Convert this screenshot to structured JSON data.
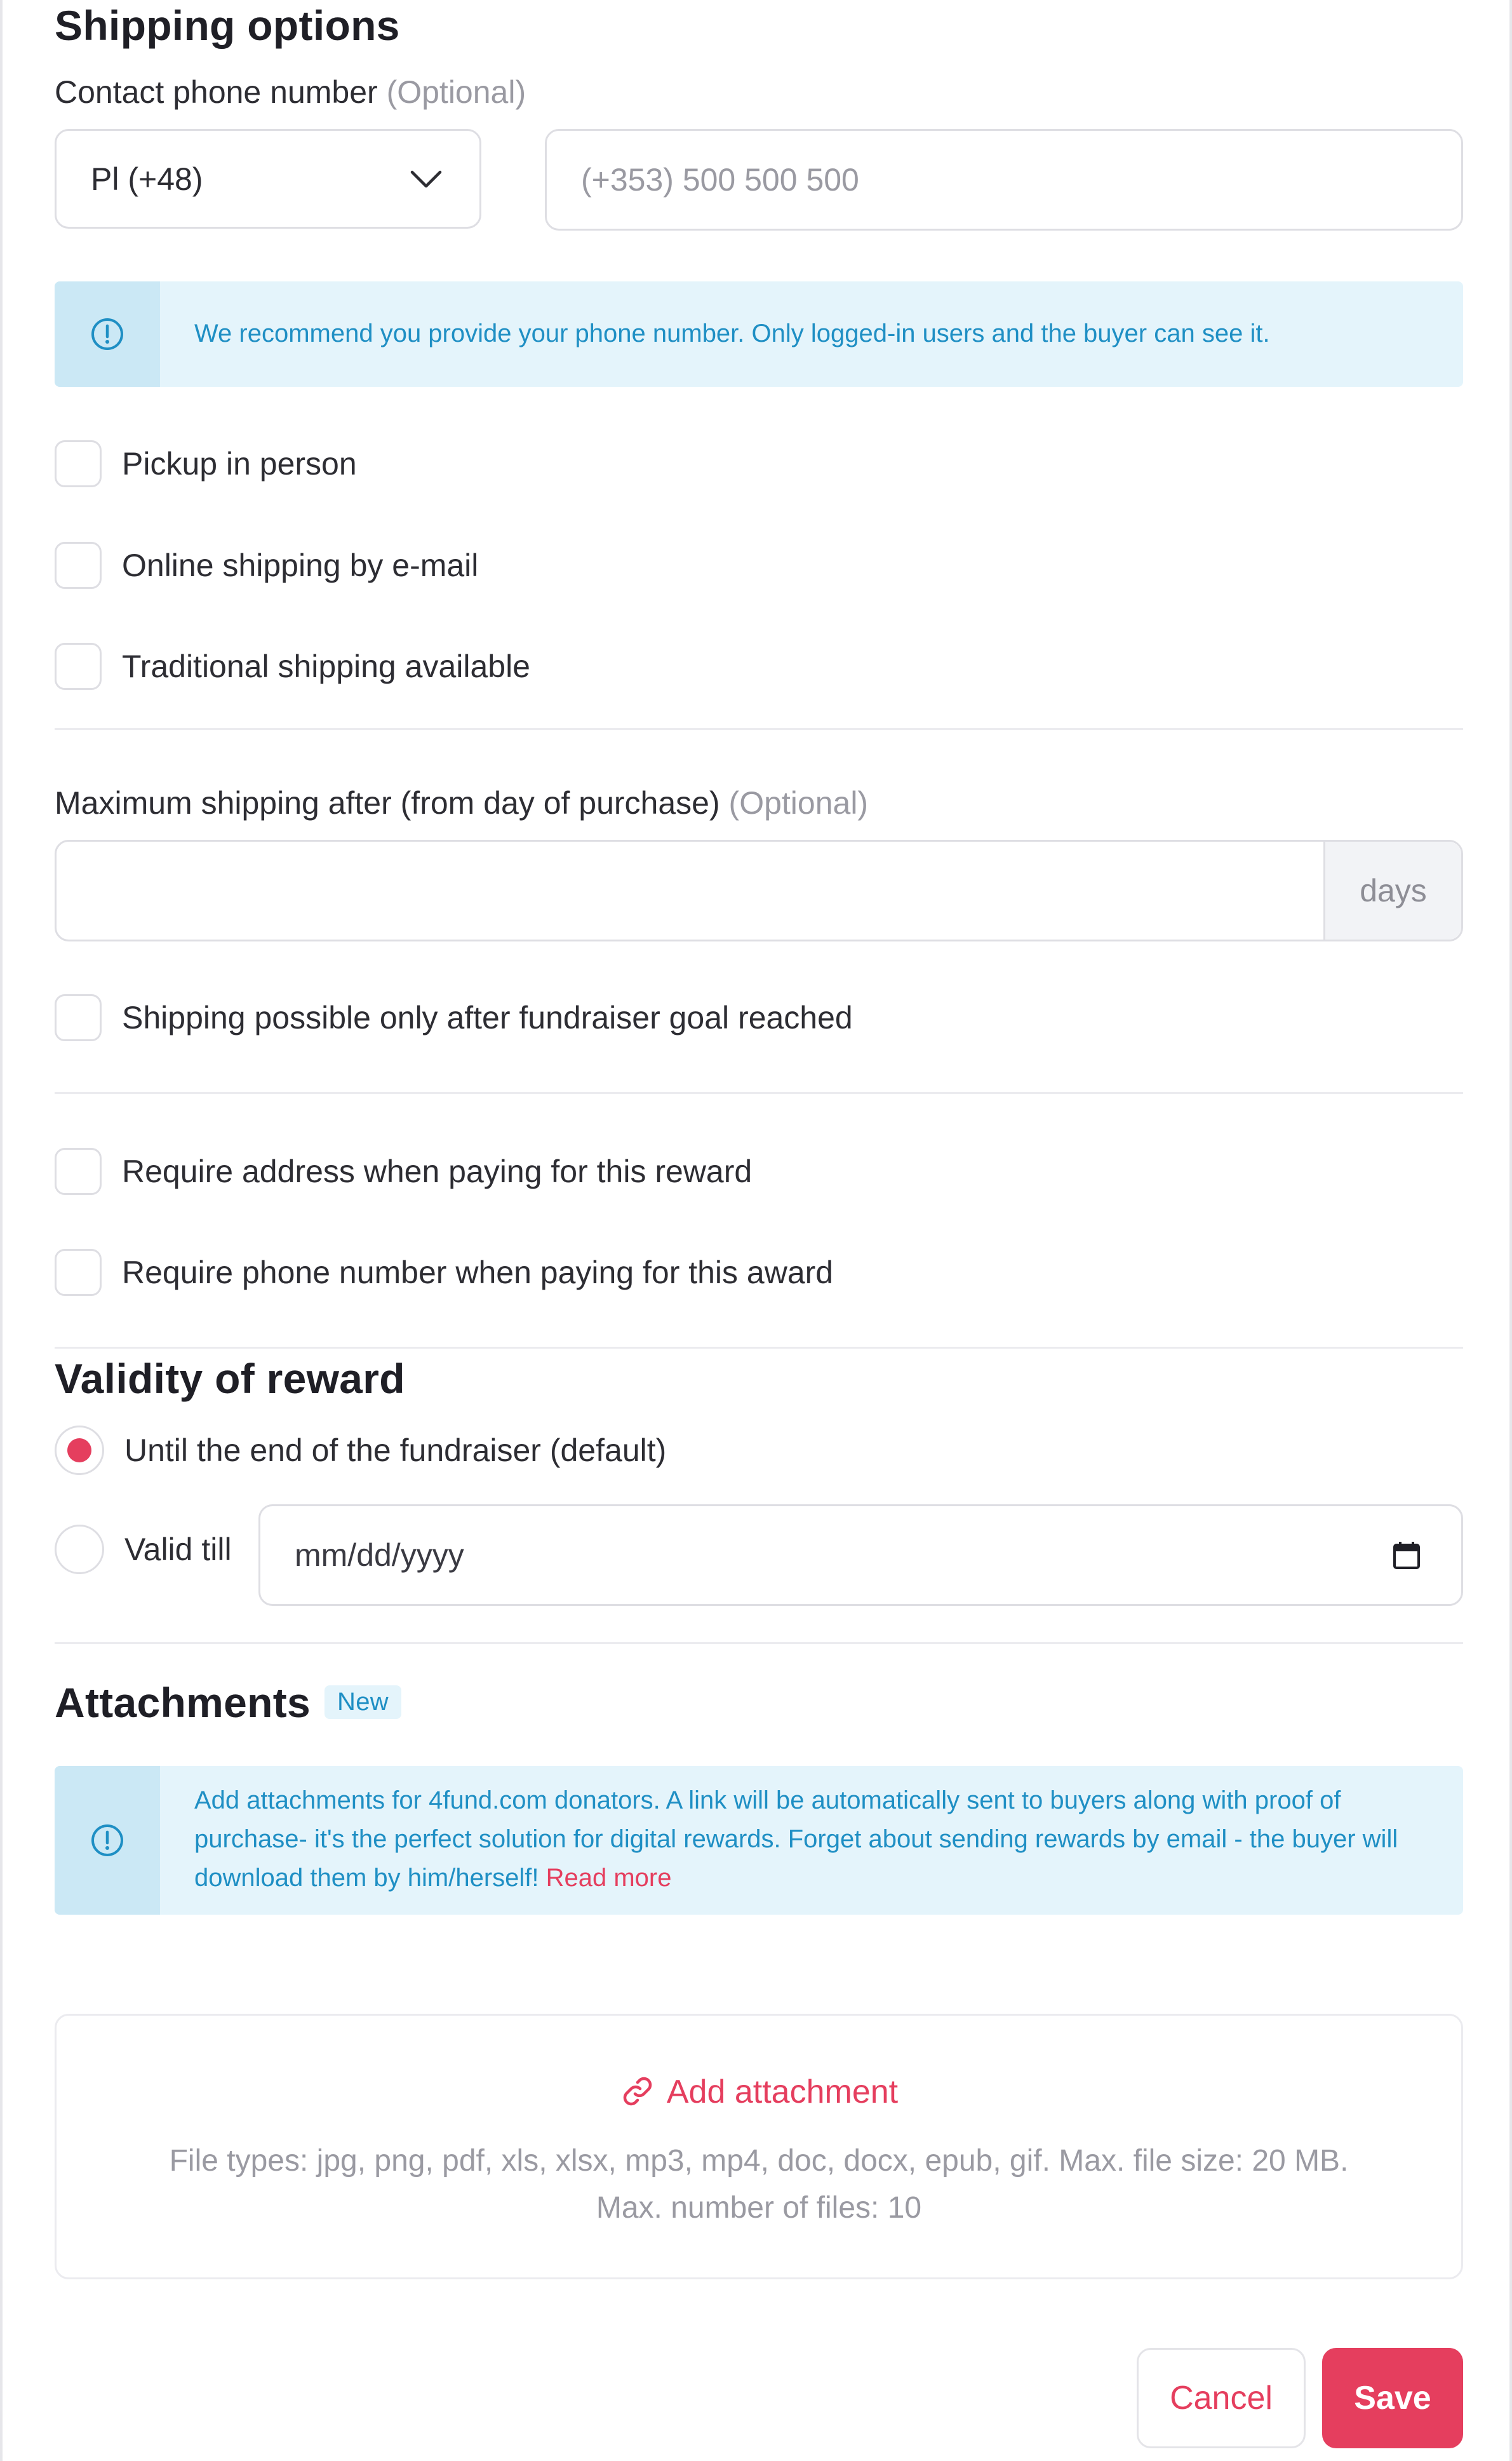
{
  "shipping": {
    "title": "Shipping options",
    "phone_label": "Contact phone number",
    "optional": "(Optional)",
    "country_code": "Pl (+48)",
    "phone_placeholder": "(+353) 500 500 500",
    "phone_info": "We recommend you provide your phone number. Only logged-in users and the buyer can see it.",
    "options": {
      "pickup": "Pickup in person",
      "online": "Online shipping by e-mail",
      "traditional": "Traditional shipping available"
    },
    "max_label": "Maximum shipping after (from day of purchase)",
    "max_value": "",
    "days_suffix": "days",
    "goal_option": "Shipping possible only after fundraiser goal reached",
    "require_address": "Require address when paying for this reward",
    "require_phone": "Require phone number when paying for this award"
  },
  "validity": {
    "title": "Validity of reward",
    "until_end": "Until the end of the fundraiser (default)",
    "valid_till": "Valid till",
    "date_placeholder": "mm/dd/yyyy"
  },
  "attachments": {
    "title": "Attachments",
    "badge": "New",
    "info": "Add attachments for 4fund.com donators. A link will be automatically sent to buyers along with proof of purchase- it's the perfect solution for digital rewards. Forget about sending rewards by email - the buyer will download them by him/herself!",
    "read_more": "Read more",
    "add_label": "Add attachment",
    "file_types": "File types: jpg, png, pdf, xls, xlsx, mp3, mp4, doc, docx, epub, gif. Max. file size: 20 MB.",
    "max_files": "Max. number of files: 10"
  },
  "actions": {
    "cancel": "Cancel",
    "save": "Save"
  },
  "colors": {
    "accent": "#e53e5e",
    "info_text": "#1f8fc4",
    "info_bg": "#e4f4fb"
  }
}
